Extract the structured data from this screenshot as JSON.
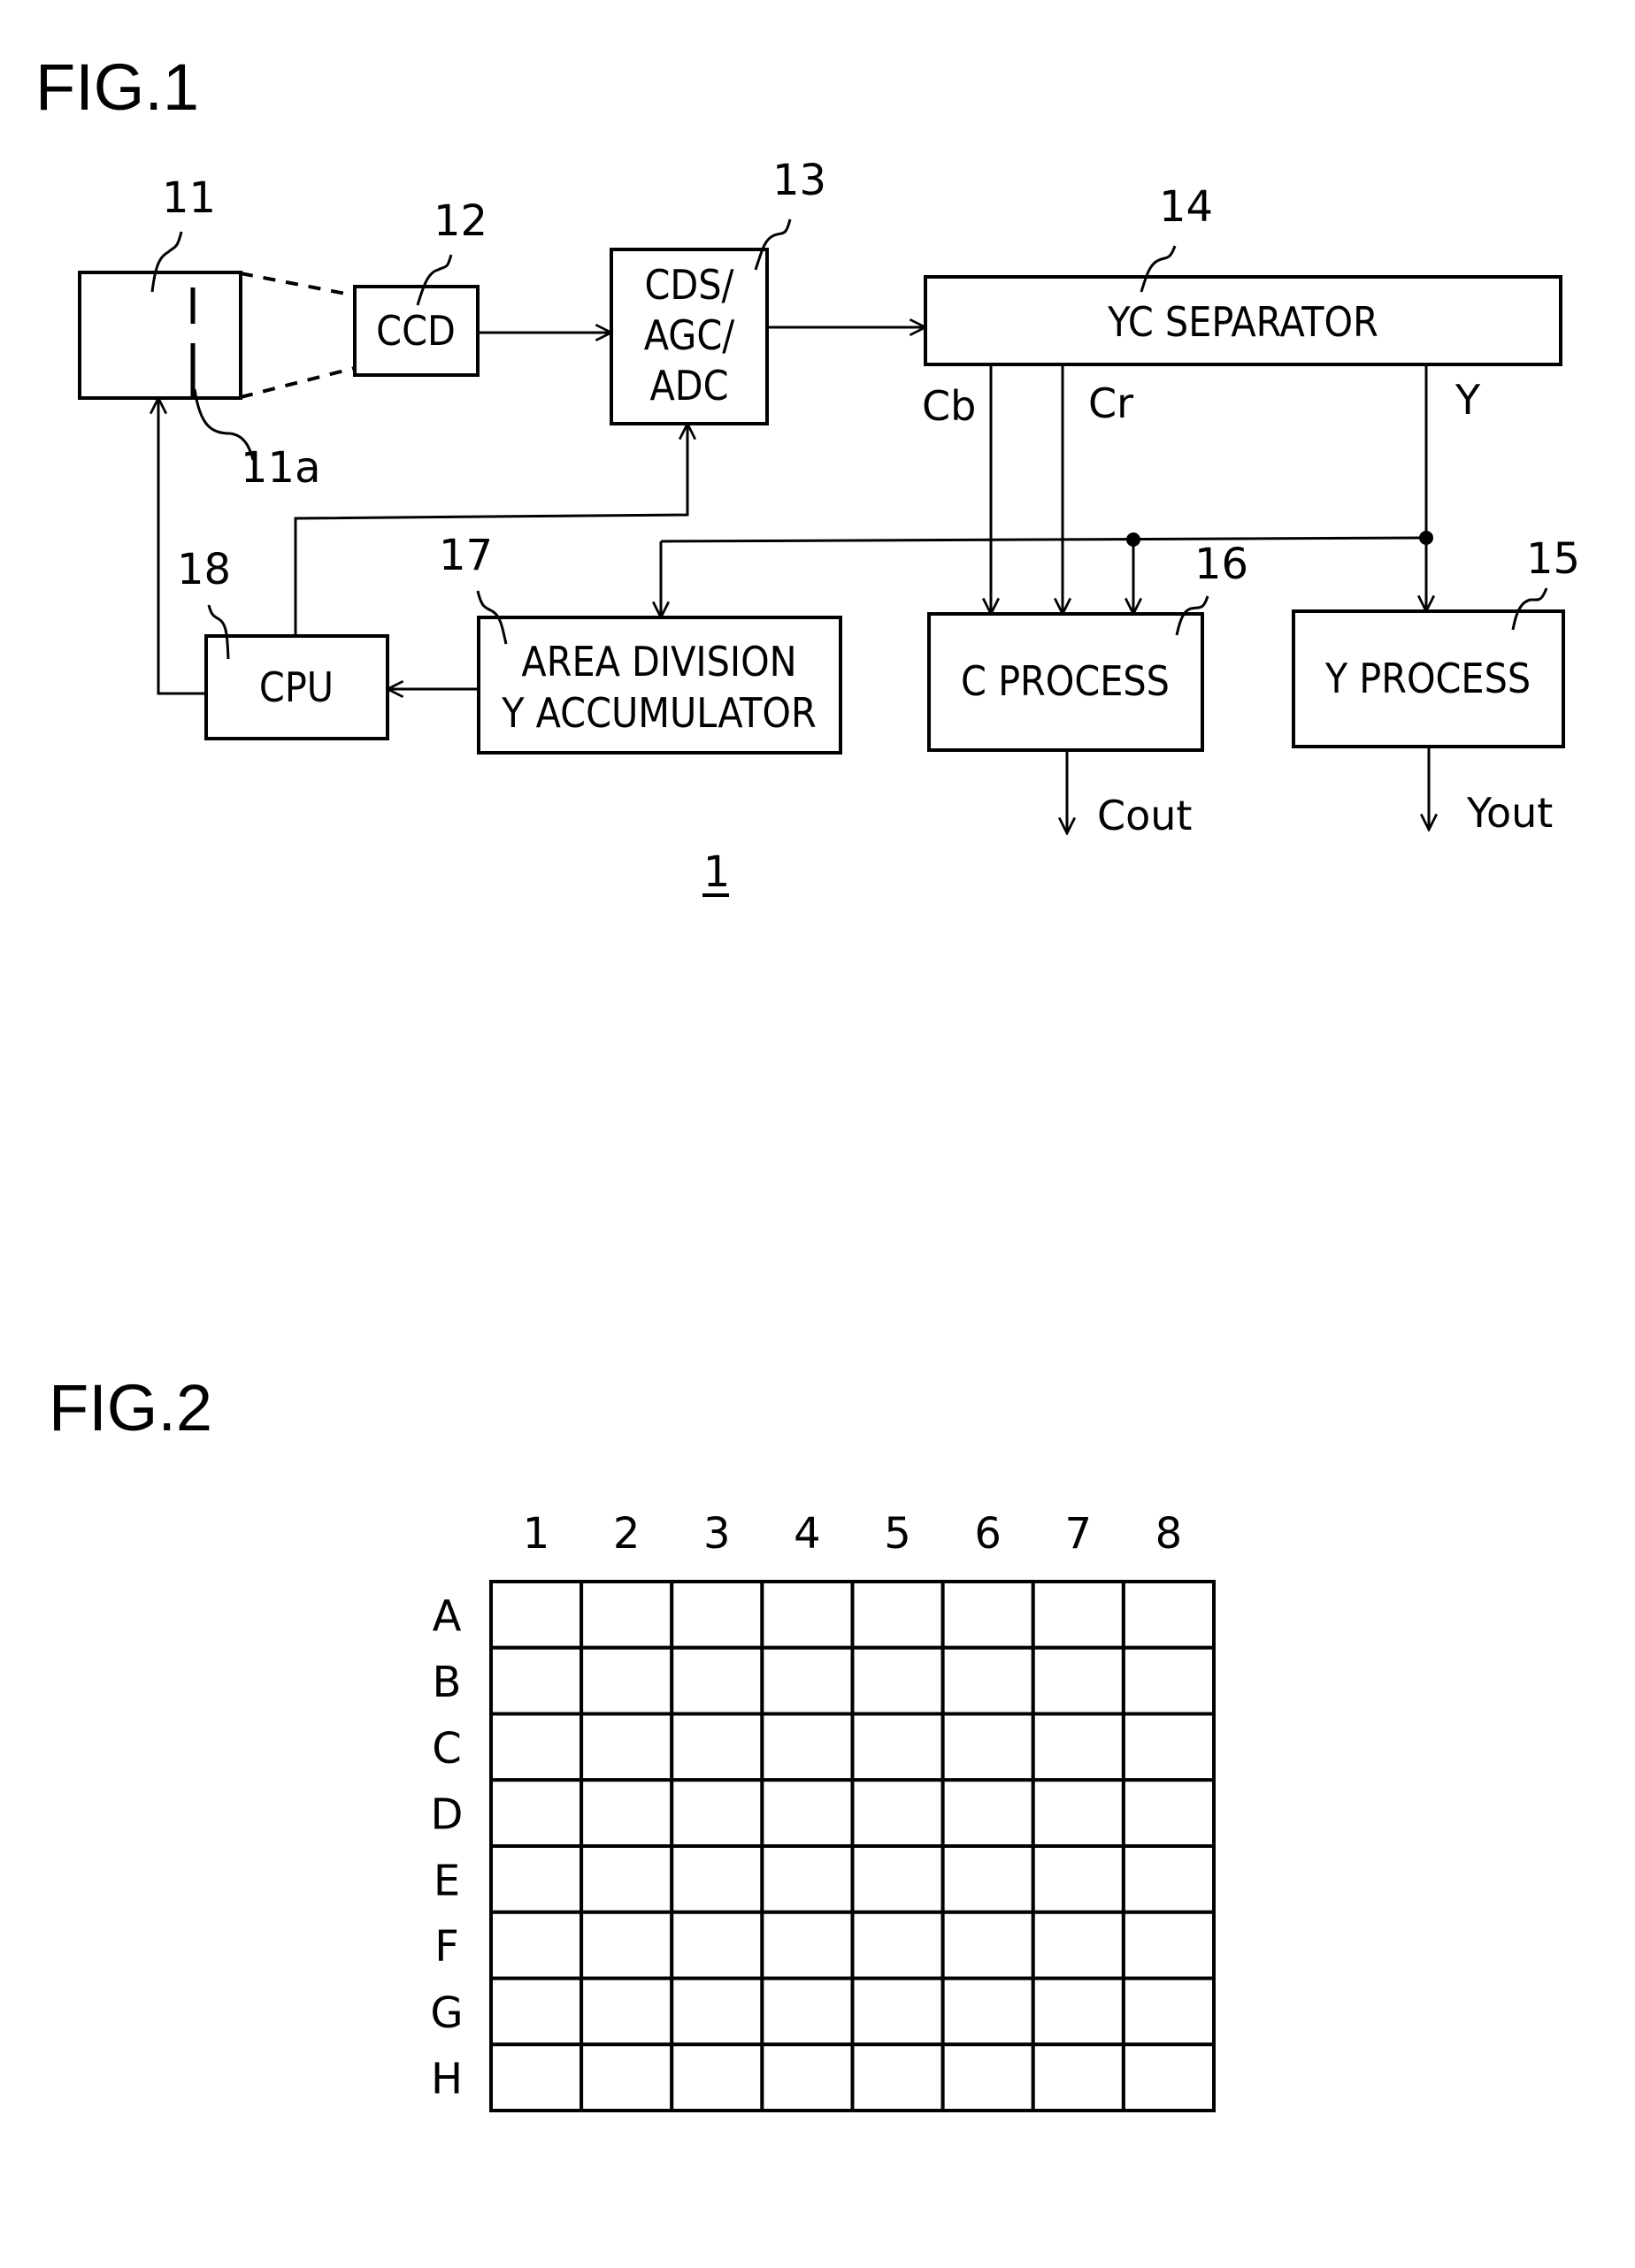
{
  "figures": {
    "fig1": {
      "title": "FIG.1",
      "system_ref": "1",
      "blocks": {
        "optics": {
          "ref": "11",
          "sub_ref": "11a",
          "label": ""
        },
        "ccd": {
          "ref": "12",
          "label": "CCD"
        },
        "cds": {
          "ref": "13",
          "lines": [
            "CDS/",
            "AGC/",
            "ADC"
          ]
        },
        "yc_separator": {
          "ref": "14",
          "label": "YC SEPARATOR"
        },
        "y_process": {
          "ref": "15",
          "label": "Y PROCESS"
        },
        "c_process": {
          "ref": "16",
          "label": "C PROCESS"
        },
        "area_div": {
          "ref": "17",
          "lines": [
            "AREA DIVISION",
            "Y ACCUMULATOR"
          ]
        },
        "cpu": {
          "ref": "18",
          "label": "CPU"
        }
      },
      "signals": {
        "cb": "Cb",
        "cr": "Cr",
        "y": "Y",
        "cout": "Cout",
        "yout": "Yout"
      }
    },
    "fig2": {
      "title": "FIG.2",
      "columns": [
        "1",
        "2",
        "3",
        "4",
        "5",
        "6",
        "7",
        "8"
      ],
      "rows": [
        "A",
        "B",
        "C",
        "D",
        "E",
        "F",
        "G",
        "H"
      ]
    }
  }
}
